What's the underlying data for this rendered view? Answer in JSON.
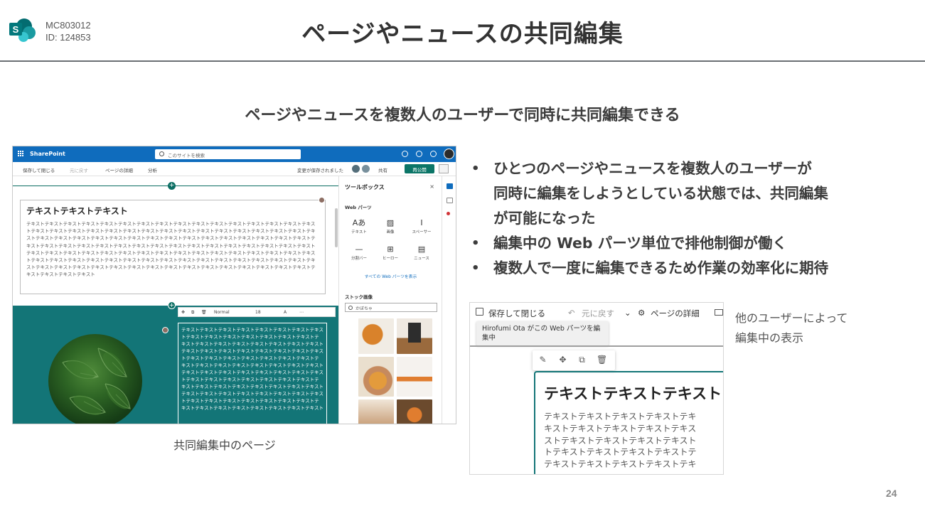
{
  "header": {
    "meta_line1": "MC803012",
    "meta_line2": "ID: 124853",
    "title": "ページやニュースの共同編集",
    "logo_icon": "sharepoint-logo-icon"
  },
  "subtitle": "ページやニュースを複数人のユーザーで同時に共同編集できる",
  "left_screenshot": {
    "caption": "共同編集中のページ",
    "suite_bar": {
      "brand": "SharePoint",
      "search_placeholder": "このサイトを検索",
      "color": "#0f6cbd"
    },
    "command_bar": {
      "save_close": "保存して閉じる",
      "undo": "元に戻す",
      "page_details": "ページの詳細",
      "analytics": "分析",
      "saved_status": "変更が保存されました",
      "share": "共有",
      "republish": "再公開"
    },
    "text_webpart": {
      "title": "テキストテキストテキスト",
      "body": "テキストテキストテキストテキストテキストテキストテキストテキストテキストテキストテキストテキストテキストテキストテキストテキストテキストテキストテキストテキストテキストテキストテキストテキストテキストテキストテキストテキストテキストテキストテキストテキストテキストテキストテキストテキストテキストテキストテキストテキストテキストテキストテキストテキストテキストテキストテキストテキストテキストテキストテキストテキストテキストテキストテキストテキストテキストテキストテキストテキストテキストテキストテキストテキストテキストテキストテキストテキストテキストテキストテキストテキストテキストテキストテキストテキストテキストテキストテキストテキストテキストテキストテキストテキストテキストテキストテキストテキストテキストテキストテキストテキストテキストテキストテキストテキストテキストテキストテキストテキストテキストテキストテキストテキストテキストテキストテキストテキストテキストテキストテキストテキストテキストテキスト"
    },
    "format_toolbar": {
      "style": "Normal",
      "size": "18"
    },
    "dark_text": "テキストテキストテキストテキストテキストテキストテキストテキストテキストテキストテキストテキストテキストテキストテキストテキストテキストテキストテキストテキストテキストテキストテキストテキストテキストテキストテキストテキストテキストテキストテキストテキストテキストテキストテキストテキストテキストテキストテキストテキストテキストテキストテキストテキストテキストテキストテキストテキストテキストテキストテキストテキストテキストテキストテキストテキストテキストテキストテキストテキストテキストテキストテキストテキストテキストテキストテキストテキストテキストテキストテキストテキストテキストテキストテキストテキストテキストテキストテキストテキストテキストテキストテキストテキストテキストテキストテキストテキストテキストテキストテキストテキスト",
    "section_color": "#137577",
    "toolbox": {
      "title": "ツールボックス",
      "close": "×",
      "webparts_heading": "Web パーツ",
      "items": [
        {
          "label": "テキスト",
          "glyph": "Aあ"
        },
        {
          "label": "画像",
          "glyph": "▨"
        },
        {
          "label": "スペーサー",
          "glyph": "Ⅰ"
        },
        {
          "label": "分割バー",
          "glyph": "—"
        },
        {
          "label": "ヒーロー",
          "glyph": "⊞"
        },
        {
          "label": "ニュース",
          "glyph": "▤"
        }
      ],
      "see_all": "すべての Web パーツを表示",
      "stock_heading": "ストック画像",
      "stock_search": "かぼちゃ"
    }
  },
  "bullets": [
    "ひとつのページやニュースを複数人のユーザーが同時に編集をしようとしている状態では、共同編集が可能になった",
    "編集中の Web パーツ単位で排他制御が働く",
    "複数人で一度に編集できるため作業の効率化に期待"
  ],
  "bullet_marker": "•",
  "right_screenshot": {
    "save_close": "保存して閉じる",
    "undo": "元に戻す",
    "page_details": "ページの詳細",
    "tooltip": "Hirofumi Ota がこの Web パーツを編集中",
    "title": "テキストテキストテキスト",
    "body_lines": [
      "テキストテキストテキストテキストテキ",
      "キストテキストテキストテキストテキス",
      "ストテキストテキストテキストテキスト",
      "トテキストテキストテキストテキストテ",
      "テキストテキストテキストテキストテキ"
    ],
    "border_color": "#137577"
  },
  "right_caption": "他のユーザーによって\n編集中の表示",
  "page_number": "24"
}
